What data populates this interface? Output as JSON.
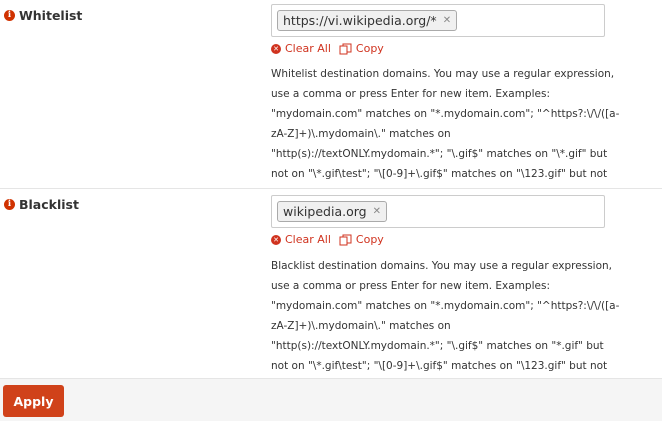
{
  "whitelist": {
    "label": "Whitelist",
    "tags": [
      "https://vi.wikipedia.org/*"
    ],
    "clear_label": "Clear All",
    "copy_label": "Copy",
    "description": "Whitelist destination domains. You may use a regular expression, use a comma or press Enter for new item. Examples: \"mydomain.com\" matches on \"*.mydomain.com\"; \"^https?:\\/\\/([a-zA-Z]+)\\.mydomain\\.\" matches on \"http(s)://textONLY.mydomain.*\"; \"\\.gif$\" matches on \"\\*.gif\" but not on \"\\*.gif\\test\"; \"\\[0-9]+\\.gif$\" matches on \"\\123.gif\" but not on \"\\test.gif\""
  },
  "blacklist": {
    "label": "Blacklist",
    "tags": [
      "wikipedia.org"
    ],
    "clear_label": "Clear All",
    "copy_label": "Copy",
    "description": "Blacklist destination domains. You may use a regular expression, use a comma or press Enter for new item. Examples: \"mydomain.com\" matches on \"*.mydomain.com\"; \"^https?:\\/\\/([a-zA-Z]+)\\.mydomain\\.\" matches on \"http(s)://textONLY.mydomain.*\"; \"\\.gif$\" matches on \"*.gif\" but not on \"\\*.gif\\test\"; \"\\[0-9]+\\.gif$\" matches on \"\\123.gif\" but not on \"\\test.gif\""
  },
  "apply_label": "Apply",
  "icons": {
    "info": "info-circle-icon",
    "clear": "times-circle-icon",
    "copy": "copy-icon"
  },
  "colors": {
    "accent": "#d0421a",
    "danger": "#d0331f"
  }
}
